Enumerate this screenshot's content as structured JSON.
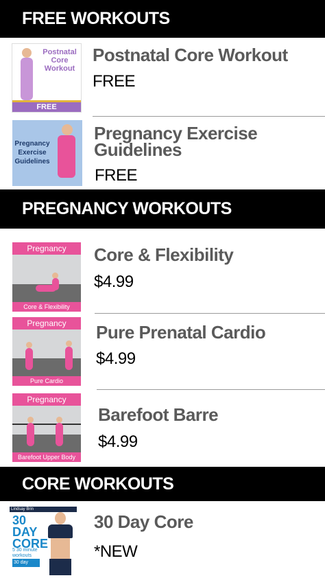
{
  "sections": [
    {
      "header": "FREE WORKOUTS",
      "items": [
        {
          "title_lines": [
            "Postnatal Core Workout"
          ],
          "price": "FREE",
          "thumb_text": "Postnatal Core Workout",
          "thumb_band": "FREE"
        },
        {
          "title_lines": [
            "Pregnancy Exercise",
            "Guidelines"
          ],
          "price": "FREE",
          "thumb_text": "Pregnancy Exercise Guidelines"
        }
      ]
    },
    {
      "header": "PREGNANCY WORKOUTS",
      "items": [
        {
          "title_lines": [
            "Core & Flexibility"
          ],
          "price": "$4.99",
          "thumb_top": "Pregnancy",
          "thumb_bottom": "Core & Flexibility"
        },
        {
          "title_lines": [
            "Pure Prenatal Cardio"
          ],
          "price": "$4.99",
          "thumb_top": "Pregnancy",
          "thumb_bottom": "Pure Cardio"
        },
        {
          "title_lines": [
            "Barefoot Barre"
          ],
          "price": "$4.99",
          "thumb_top": "Pregnancy",
          "thumb_bottom": "Barefoot Upper Body"
        }
      ]
    },
    {
      "header": "CORE WORKOUTS",
      "items": [
        {
          "title_lines": [
            "30 Day Core"
          ],
          "price": "*NEW",
          "thumb_brand": "Lindsay Brin",
          "thumb_big_1": "30",
          "thumb_big_2": "DAY",
          "thumb_big_3": "CORE",
          "thumb_bullet": "5 30 minute workouts",
          "thumb_cal": "30 day calendar"
        }
      ]
    }
  ],
  "colors": {
    "header_bg": "#000000",
    "title_color": "#5a5a5a",
    "pregnancy_pink": "#e8539a"
  }
}
